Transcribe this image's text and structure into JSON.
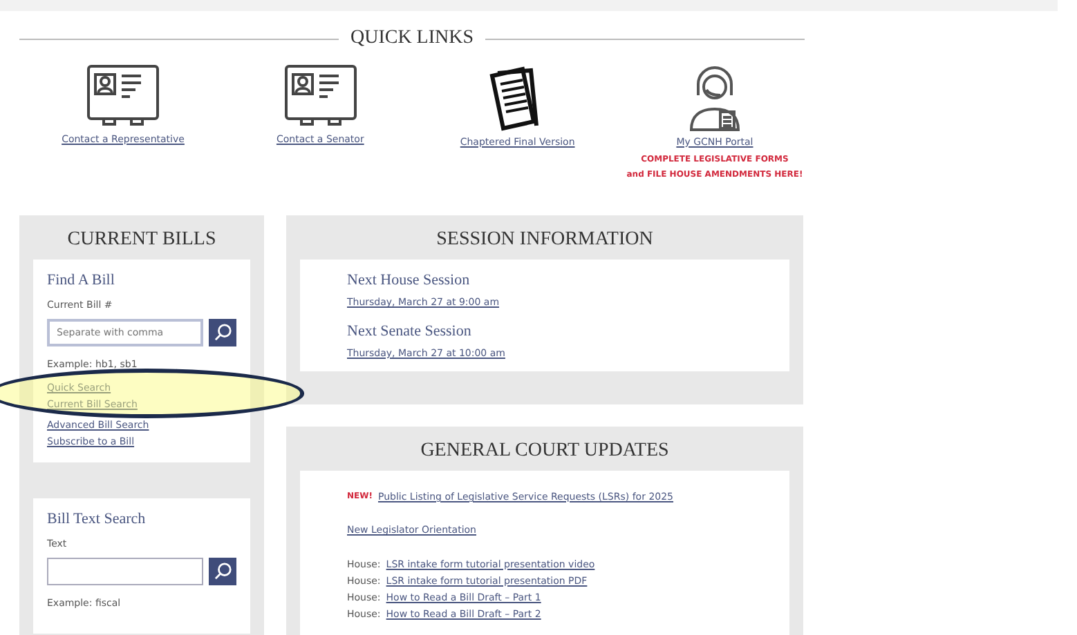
{
  "quick_links": {
    "title": "QUICK LINKS",
    "items": [
      {
        "kind": "card",
        "label": "Contact a Representative"
      },
      {
        "kind": "card",
        "label": "Contact a Senator"
      },
      {
        "kind": "papers",
        "label": "Chaptered Final Version"
      },
      {
        "kind": "agent",
        "label": "My GCNH Portal",
        "notes": [
          "COMPLETE LEGISLATIVE FORMS",
          "and FILE HOUSE AMENDMENTS HERE!"
        ]
      }
    ]
  },
  "current_bills": {
    "title": "CURRENT BILLS",
    "find_a_bill": {
      "heading": "Find A Bill",
      "label": "Current Bill #",
      "placeholder": "Separate with comma",
      "example": "Example: hb1, sb1",
      "links": [
        "Quick Search",
        "Current Bill Search",
        "Advanced Bill Search",
        "Subscribe to a Bill"
      ]
    },
    "bill_text_search": {
      "heading": "Bill Text Search",
      "label": "Text",
      "example": "Example: fiscal"
    }
  },
  "session_information": {
    "title": "SESSION INFORMATION",
    "items": [
      {
        "heading": "Next House Session",
        "date": "Thursday, March 27 at 9:00 am"
      },
      {
        "heading": "Next Senate Session",
        "date": "Thursday, March 27 at 10:00 am"
      }
    ]
  },
  "general_court_updates": {
    "title": "GENERAL COURT UPDATES",
    "items": [
      {
        "kind": "new",
        "badge": "NEW!",
        "link": "Public Listing of Legislative Service Requests (LSRs) for 2025"
      },
      {
        "kind": "link",
        "link": "New Legislator Orientation"
      },
      {
        "kind": "prefixed",
        "prefix": "House:",
        "link": "LSR intake form tutorial presentation video"
      },
      {
        "kind": "prefixed",
        "prefix": "House:",
        "link": "LSR intake form tutorial presentation PDF"
      },
      {
        "kind": "prefixed",
        "prefix": "House:",
        "link": "How to Read a Bill Draft – Part 1"
      },
      {
        "kind": "prefixed",
        "prefix": "House:",
        "link": "How to Read a Bill Draft – Part 2"
      }
    ]
  }
}
